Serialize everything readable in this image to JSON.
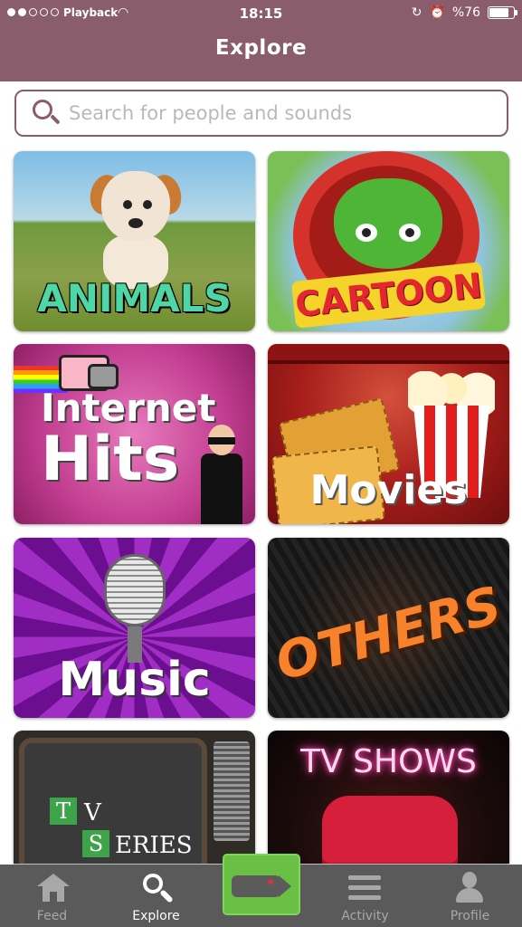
{
  "status_bar": {
    "carrier": "Playback",
    "time": "18:15",
    "battery_text": "%76",
    "battery_level": 0.76,
    "signal_dots_filled": 2,
    "signal_dots_total": 5
  },
  "header": {
    "title": "Explore",
    "background_color": "#8a5d6c"
  },
  "search": {
    "placeholder": "Search for people and sounds",
    "value": ""
  },
  "categories": [
    {
      "id": "animals",
      "label": "ANIMALS"
    },
    {
      "id": "cartoon",
      "label": "CARTOON"
    },
    {
      "id": "internet-hits",
      "label_line1": "Internet",
      "label_line2": "Hits"
    },
    {
      "id": "movies",
      "label": "Movies"
    },
    {
      "id": "music",
      "label": "Music"
    },
    {
      "id": "others",
      "label": "OTHERS"
    },
    {
      "id": "tv-series",
      "box_t": "T",
      "word_v": "V",
      "box_s": "S",
      "word_eries": "ERIES"
    },
    {
      "id": "tv-shows",
      "label": "TV SHOWS"
    }
  ],
  "tabbar": {
    "tabs": [
      {
        "id": "feed",
        "label": "Feed",
        "icon": "home-icon",
        "active": false
      },
      {
        "id": "explore",
        "label": "Explore",
        "icon": "search-icon",
        "active": true
      },
      {
        "id": "record",
        "label": "",
        "icon": "video-camera-icon",
        "active": false
      },
      {
        "id": "activity",
        "label": "Activity",
        "icon": "list-icon",
        "active": false
      },
      {
        "id": "profile",
        "label": "Profile",
        "icon": "user-icon",
        "active": false
      }
    ],
    "record_color": "#6abf45"
  }
}
